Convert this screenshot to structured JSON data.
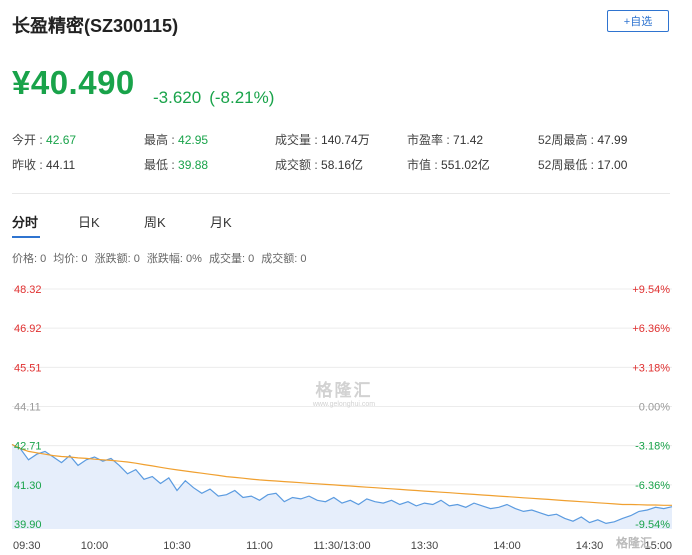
{
  "header": {
    "title": "长盈精密(SZ300115)",
    "add_button": "+自选"
  },
  "quote": {
    "price": "¥40.490",
    "change": "-3.620",
    "change_pct": "(-8.21%)"
  },
  "stats": {
    "row1": [
      {
        "label": "今开 : ",
        "value": "42.67",
        "green": true
      },
      {
        "label": "最高 : ",
        "value": "42.95",
        "green": true
      },
      {
        "label": "成交量 : ",
        "value": "140.74万",
        "green": false
      },
      {
        "label": "市盈率 : ",
        "value": "71.42",
        "green": false
      },
      {
        "label": "52周最高 : ",
        "value": "47.99",
        "green": false
      }
    ],
    "row2": [
      {
        "label": "昨收 : ",
        "value": "44.11",
        "green": false
      },
      {
        "label": "最低 : ",
        "value": "39.88",
        "green": true
      },
      {
        "label": "成交额 : ",
        "value": "58.16亿",
        "green": false
      },
      {
        "label": "市值 : ",
        "value": "551.02亿",
        "green": false
      },
      {
        "label": "52周最低 : ",
        "value": "17.00",
        "green": false
      }
    ]
  },
  "tabs": [
    "分时",
    "日K",
    "周K",
    "月K"
  ],
  "info_bar": [
    "价格: 0",
    "均价: 0",
    "涨跌额: 0",
    "涨跌幅: 0%",
    "成交量: 0",
    "成交额: 0"
  ],
  "watermark": {
    "main": "格隆汇",
    "sub": "www.gelonghui.com"
  },
  "corner_logo": "格隆汇",
  "colors": {
    "up": "#e03030",
    "down": "#19a34a",
    "price_line": "#5b9be0",
    "avg_line": "#f0a030",
    "area": "#e6eefb"
  },
  "chart_data": {
    "type": "line",
    "y_left_ticks": [
      "48.32",
      "46.92",
      "45.51",
      "44.11",
      "42.71",
      "41.30",
      "39.90"
    ],
    "y_right_ticks": [
      "+9.54%",
      "+6.36%",
      "+3.18%",
      "0.00%",
      "-3.18%",
      "-6.36%",
      "-9.54%"
    ],
    "x_ticks": [
      "09:30",
      "10:00",
      "10:30",
      "11:00",
      "11:30/13:00",
      "13:30",
      "14:00",
      "14:30",
      "15:00"
    ],
    "ylim": [
      39.9,
      48.32
    ],
    "series": [
      {
        "values": [
          42.75,
          42.6,
          42.2,
          42.4,
          42.5,
          42.3,
          42.1,
          42.35,
          42.0,
          42.2,
          42.3,
          42.15,
          42.25,
          42.0,
          41.7,
          41.85,
          41.5,
          41.6,
          41.35,
          41.55,
          41.1,
          41.45,
          41.2,
          41.0,
          41.15,
          40.9,
          40.95,
          41.1,
          40.85,
          40.9,
          40.75,
          40.95,
          41.0,
          40.7,
          40.85,
          40.8,
          40.9,
          40.75,
          40.7,
          40.85,
          40.65,
          40.75,
          40.6,
          40.8,
          40.7,
          40.65,
          40.75,
          40.6,
          40.7,
          40.55,
          40.65,
          40.6,
          40.75,
          40.55,
          40.6,
          40.5,
          40.65,
          40.55,
          40.45,
          40.5,
          40.6,
          40.45,
          40.35,
          40.4,
          40.3,
          40.2,
          40.25,
          40.1,
          40.0,
          40.15,
          39.95,
          40.05,
          39.92,
          39.98,
          40.1,
          40.2,
          40.35,
          40.4,
          40.5,
          40.45,
          40.52
        ]
      },
      {
        "values": [
          42.75,
          42.6,
          42.5,
          42.45,
          42.4,
          42.35,
          42.32,
          42.3,
          42.27,
          42.25,
          42.22,
          42.2,
          42.18,
          42.15,
          42.12,
          42.08,
          42.03,
          41.98,
          41.93,
          41.88,
          41.84,
          41.8,
          41.76,
          41.72,
          41.68,
          41.64,
          41.6,
          41.57,
          41.54,
          41.51,
          41.48,
          41.46,
          41.44,
          41.42,
          41.4,
          41.38,
          41.36,
          41.34,
          41.32,
          41.3,
          41.28,
          41.26,
          41.24,
          41.22,
          41.2,
          41.18,
          41.16,
          41.14,
          41.12,
          41.1,
          41.08,
          41.06,
          41.04,
          41.02,
          41.0,
          40.98,
          40.96,
          40.94,
          40.92,
          40.9,
          40.88,
          40.86,
          40.84,
          40.82,
          40.8,
          40.78,
          40.76,
          40.74,
          40.72,
          40.7,
          40.68,
          40.66,
          40.64,
          40.62,
          40.6,
          40.6,
          40.59,
          40.58,
          40.58,
          40.57,
          40.57
        ]
      }
    ]
  }
}
